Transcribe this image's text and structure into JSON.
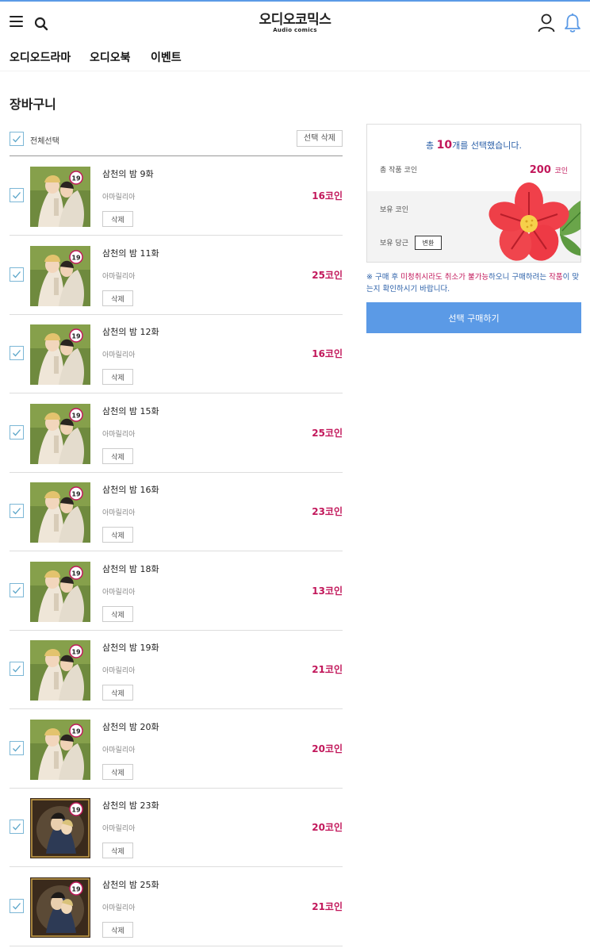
{
  "logo": {
    "main": "오디오코믹스",
    "sub": "Audio comics"
  },
  "nav": [
    {
      "label": "오디오드라마"
    },
    {
      "label": "오디오북"
    },
    {
      "label": "이벤트"
    }
  ],
  "page_title": "장바구니",
  "select_all_label": "전체선택",
  "delete_selected_label": "선택 삭제",
  "delete_label": "삭제",
  "items": [
    {
      "title": "삼천의 밤 9화",
      "author": "아마릴리아",
      "price": "16코인",
      "rating": "19",
      "cover": "green"
    },
    {
      "title": "삼천의 밤 11화",
      "author": "아마릴리아",
      "price": "25코인",
      "rating": "19",
      "cover": "green"
    },
    {
      "title": "삼천의 밤 12화",
      "author": "아마릴리아",
      "price": "16코인",
      "rating": "19",
      "cover": "green"
    },
    {
      "title": "삼천의 밤 15화",
      "author": "아마릴리아",
      "price": "25코인",
      "rating": "19",
      "cover": "green"
    },
    {
      "title": "삼천의 밤 16화",
      "author": "아마릴리아",
      "price": "23코인",
      "rating": "19",
      "cover": "green"
    },
    {
      "title": "삼천의 밤 18화",
      "author": "아마릴리아",
      "price": "13코인",
      "rating": "19",
      "cover": "green"
    },
    {
      "title": "삼천의 밤 19화",
      "author": "아마릴리아",
      "price": "21코인",
      "rating": "19",
      "cover": "green"
    },
    {
      "title": "삼천의 밤 20화",
      "author": "아마릴리아",
      "price": "20코인",
      "rating": "19",
      "cover": "green"
    },
    {
      "title": "삼천의 밤 23화",
      "author": "아마릴리아",
      "price": "20코인",
      "rating": "19",
      "cover": "dark"
    },
    {
      "title": "삼천의 밤 25화",
      "author": "아마릴리아",
      "price": "21코인",
      "rating": "19",
      "cover": "dark"
    }
  ],
  "summary": {
    "head_prefix": "총 ",
    "head_count": "10",
    "head_suffix": "개를 선택했습니다.",
    "total_label": "총 작품 코인",
    "total_value": "200",
    "total_unit": "코인",
    "owned_coin_label": "보유 코인",
    "owned_carrot_label": "보유 당근",
    "convert_label": "변환"
  },
  "notice": {
    "mark": "※ ",
    "p1": "구매 후 ",
    "p2": "미청취시라도 취소가 불가능",
    "p3": "하오니 구매하려는 ",
    "p4": "작품",
    "p5": "이 맞는지 확인하시기 바랍니다."
  },
  "buy_button": "선택 구매하기",
  "colors": {
    "accent": "#5b9ae6",
    "price": "#c2185b",
    "checkbox": "#7cb7d6"
  }
}
